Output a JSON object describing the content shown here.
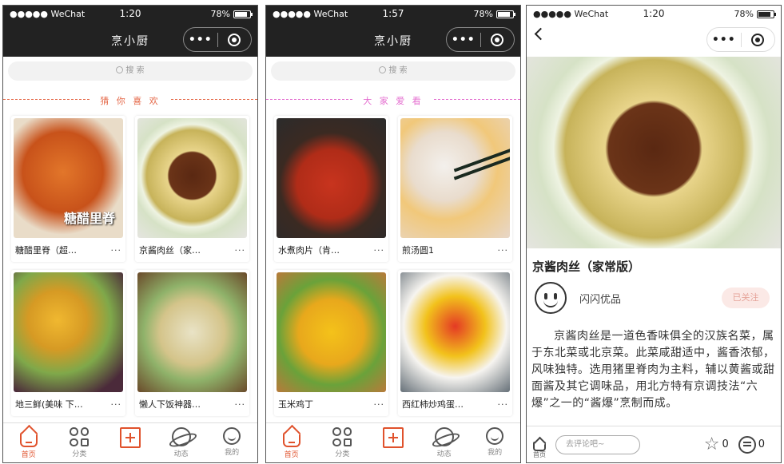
{
  "status": {
    "carrier": "●●●●● WeChat",
    "battery": "78%"
  },
  "app_title": "烹小厨",
  "capsule": {
    "more": "•••"
  },
  "search": {
    "placeholder": "搜 索"
  },
  "colors": {
    "accent": "#e0522c",
    "section1": "#e56a4a",
    "section2": "#e46fd0",
    "follow_bg": "#fbe9e6"
  },
  "screens": [
    {
      "time": "1:20",
      "section": "猜 你 喜 欢",
      "watermark": "糖醋里脊",
      "cards": [
        {
          "title": "糖醋里脊（超…",
          "more": "···"
        },
        {
          "title": "京酱肉丝（家…",
          "more": "···"
        },
        {
          "title": "地三鲜(美味 下…",
          "more": "···"
        },
        {
          "title": "懒人下饭神器…",
          "more": "···"
        }
      ]
    },
    {
      "time": "1:57",
      "section": "大 家 爱 看",
      "cards": [
        {
          "title": "水煮肉片（肯…",
          "more": "···"
        },
        {
          "title": "煎汤圆1",
          "more": "···"
        },
        {
          "title": "玉米鸡丁",
          "more": "···"
        },
        {
          "title": "西红柿炒鸡蛋…",
          "more": "···"
        }
      ]
    }
  ],
  "tabbar": [
    {
      "label": "首页",
      "icon": "home-icon",
      "active": true
    },
    {
      "label": "分类",
      "icon": "category-icon"
    },
    {
      "label": "",
      "icon": "add-icon"
    },
    {
      "label": "动态",
      "icon": "planet-icon"
    },
    {
      "label": "我的",
      "icon": "profile-icon"
    }
  ],
  "detail": {
    "time": "1:20",
    "title": "京酱肉丝（家常版）",
    "author": "闪闪优品",
    "follow": "已关注",
    "description": "京酱肉丝是一道色香味俱全的汉族名菜，属于东北菜或北京菜。此菜咸甜适中，酱香浓郁，风味独特。选用猪里脊肉为主料，辅以黄酱或甜面酱及其它调味品，用北方特有京调技法“六爆”之一的“酱爆”烹制而成。",
    "comment_placeholder": "去评论吧~",
    "home_label": "首页",
    "likes": "0",
    "comments": "0"
  }
}
